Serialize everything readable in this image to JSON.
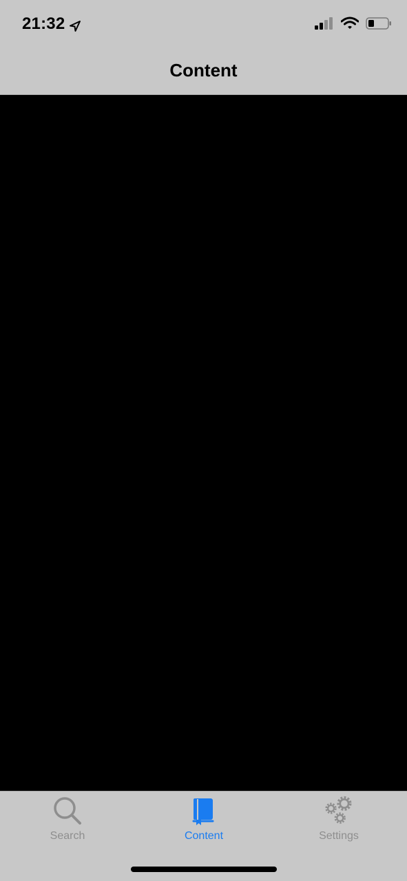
{
  "status_bar": {
    "time": "21:32",
    "icons": [
      "location-arrow-icon",
      "cellular-signal-icon",
      "wifi-icon",
      "battery-icon"
    ]
  },
  "nav": {
    "title": "Content"
  },
  "tab_bar": {
    "tabs": [
      {
        "label": "Search",
        "icon": "search-icon",
        "active": false
      },
      {
        "label": "Content",
        "icon": "book-icon",
        "active": true
      },
      {
        "label": "Settings",
        "icon": "gears-icon",
        "active": false
      }
    ]
  },
  "colors": {
    "bar_background": "#c8c8c8",
    "content_background": "#000000",
    "active_tab": "#1a7cf0",
    "inactive_tab": "#8e8e8e"
  }
}
